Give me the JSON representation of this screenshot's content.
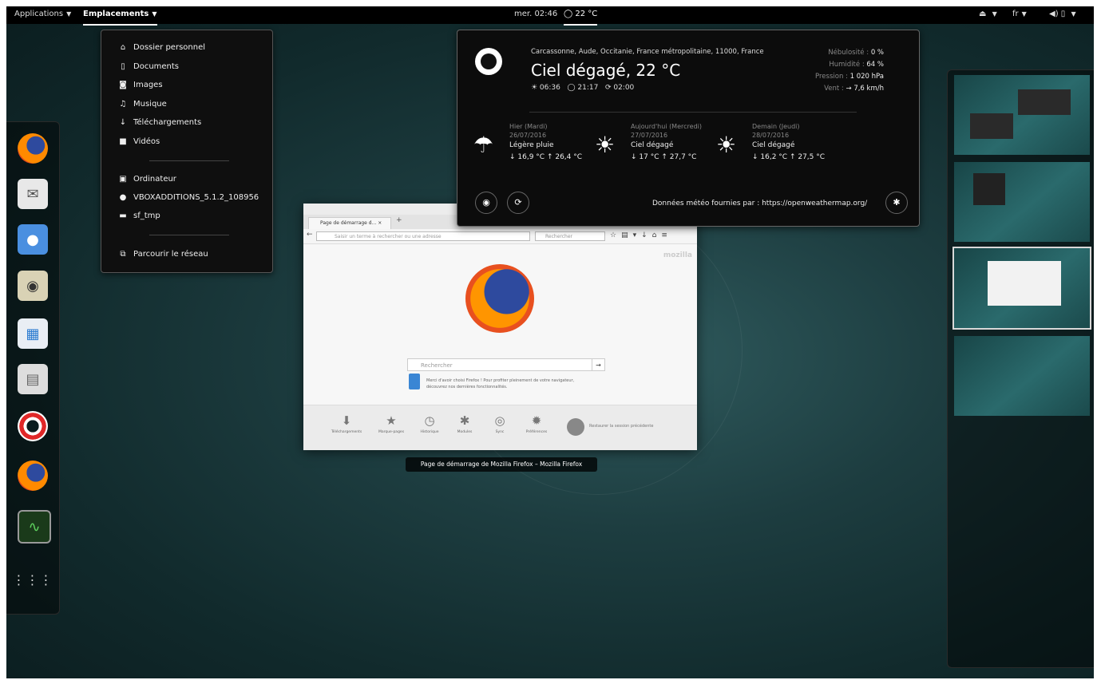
{
  "topbar": {
    "applications": "Applications",
    "places": "Emplacements",
    "clock": "mer. 02:46",
    "weather": "22 °C",
    "lang": "fr"
  },
  "places_menu": {
    "items": [
      {
        "icon": "home-icon",
        "glyph": "⌂",
        "label": "Dossier personnel"
      },
      {
        "icon": "document-icon",
        "glyph": "▯",
        "label": "Documents"
      },
      {
        "icon": "camera-icon",
        "glyph": "◙",
        "label": "Images"
      },
      {
        "icon": "music-icon",
        "glyph": "♫",
        "label": "Musique"
      },
      {
        "icon": "download-icon",
        "glyph": "↓",
        "label": "Téléchargements"
      },
      {
        "icon": "video-icon",
        "glyph": "■",
        "label": "Vidéos"
      }
    ],
    "devices": [
      {
        "icon": "computer-icon",
        "glyph": "▣",
        "label": "Ordinateur"
      },
      {
        "icon": "disc-icon",
        "glyph": "●",
        "label": "VBOXADDITIONS_5.1.2_108956"
      },
      {
        "icon": "drive-icon",
        "glyph": "▬",
        "label": "sf_tmp"
      }
    ],
    "network": {
      "icon": "network-icon",
      "glyph": "⧉",
      "label": "Parcourir le réseau"
    }
  },
  "weather": {
    "location": "Carcassonne, Aude, Occitanie, France métropolitaine, 11000, France",
    "condition": "Ciel dégagé, 22 °C",
    "sunrise": "☀ 06:36",
    "sunset": "◯ 21:17",
    "updated": "⟳ 02:00",
    "details": [
      {
        "label": "Nébulosité : ",
        "value": "0 %"
      },
      {
        "label": "Humidité : ",
        "value": "64 %"
      },
      {
        "label": "Pression : ",
        "value": "1 020 hPa"
      },
      {
        "label": "Vent : ",
        "value": "→ 7,6 km/h"
      }
    ],
    "forecast": [
      {
        "day": "Hier (Mardi)",
        "date": "26/07/2016",
        "desc": "Légère pluie",
        "temps": "↓ 16,9 °C   ↑ 26,4 °C",
        "icon": "rain-icon",
        "glyph": "☂"
      },
      {
        "day": "Aujourd'hui (Mercredi)",
        "date": "27/07/2016",
        "desc": "Ciel dégagé",
        "temps": "↓ 17 °C   ↑ 27,7 °C",
        "icon": "sun-icon",
        "glyph": "☀"
      },
      {
        "day": "Demain (Jeudi)",
        "date": "28/07/2016",
        "desc": "Ciel dégagé",
        "temps": "↓ 16,2 °C   ↑ 27,5 °C",
        "icon": "sun-icon",
        "glyph": "☀"
      }
    ],
    "credit": "Données météo fournies par :  https://openweathermap.org/"
  },
  "firefox": {
    "window_title": "Page de dé",
    "tab_label": "Page de démarrage d... ×",
    "url_placeholder": "Saisir un terme à rechercher ou une adresse",
    "search_placeholder": "Rechercher",
    "brand": "mozilla",
    "home_search_placeholder": "Rechercher",
    "snippet": "Merci d'avoir choisi Firefox ! Pour profiter pleinement de votre navigateur, découvrez nos dernières fonctionnalités.",
    "launchers": [
      "Téléchargements",
      "Marque-pages",
      "Historique",
      "Modules",
      "Sync",
      "Préférences"
    ],
    "restore": "Restaurer la session précédente",
    "caption": "Page de démarrage de Mozilla Firefox – Mozilla Firefox"
  },
  "colors": {
    "accent": "#ffffff",
    "bar": "#000000",
    "desktop": "#1d3d40"
  }
}
